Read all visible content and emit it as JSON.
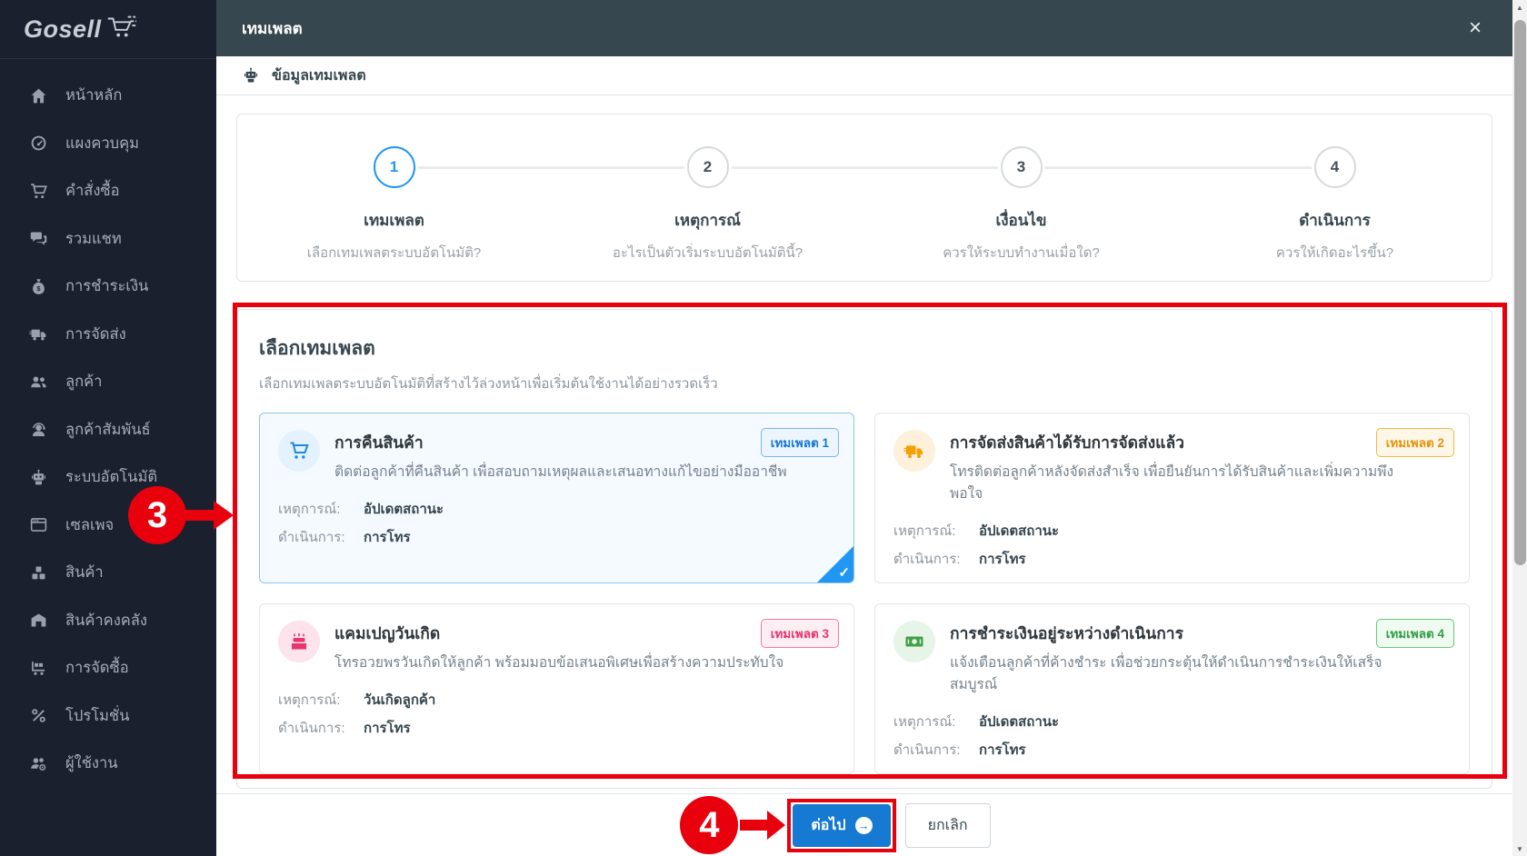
{
  "brand": {
    "name": "Gosell"
  },
  "sidebar": {
    "items": [
      {
        "label": "หน้าหลัก",
        "icon": "home-icon"
      },
      {
        "label": "แผงควบคุม",
        "icon": "dashboard-gauge-icon"
      },
      {
        "label": "คำสั่งซื้อ",
        "icon": "orders-cart-icon"
      },
      {
        "label": "รวมแชท",
        "icon": "chat-icon"
      },
      {
        "label": "การชำระเงิน",
        "icon": "payment-moneybag-icon"
      },
      {
        "label": "การจัดส่ง",
        "icon": "shipping-truck-icon"
      },
      {
        "label": "ลูกค้า",
        "icon": "customers-icon"
      },
      {
        "label": "ลูกค้าสัมพันธ์",
        "icon": "crm-agent-icon"
      },
      {
        "label": "ระบบอัตโนมัติ",
        "icon": "automation-robot-icon"
      },
      {
        "label": "เซลเพจ",
        "icon": "salepage-window-icon"
      },
      {
        "label": "สินค้า",
        "icon": "products-boxes-icon"
      },
      {
        "label": "สินค้าคงคลัง",
        "icon": "inventory-warehouse-icon"
      },
      {
        "label": "การจัดซื้อ",
        "icon": "purchasing-cart-icon"
      },
      {
        "label": "โปรโมชั่น",
        "icon": "promotion-percent-icon"
      },
      {
        "label": "ผู้ใช้งาน",
        "icon": "users-gear-icon"
      }
    ]
  },
  "modal": {
    "title": "เทมเพลต",
    "subheader": "ข้อมูลเทมเพลต",
    "steps": [
      {
        "number": "1",
        "label": "เทมเพลต",
        "description": "เลือกเทมเพลตระบบอัตโนมัติ?",
        "active": true
      },
      {
        "number": "2",
        "label": "เหตุการณ์",
        "description": "อะไรเป็นตัวเริ่มระบบอัตโนมัตินี้?",
        "active": false
      },
      {
        "number": "3",
        "label": "เงื่อนไข",
        "description": "ควรให้ระบบทำงานเมื่อใด?",
        "active": false
      },
      {
        "number": "4",
        "label": "ดำเนินการ",
        "description": "ควรให้เกิดอะไรขึ้น?",
        "active": false
      }
    ],
    "section": {
      "title": "เลือกเทมเพลต",
      "subtitle": "เลือกเทมเพลตระบบอัตโนมัติที่สร้างไว้ล่วงหน้าเพื่อเริ่มต้นใช้งานได้อย่างรวดเร็ว",
      "event_label": "เหตุการณ์:",
      "action_label": "ดำเนินการ:",
      "templates": [
        {
          "title": "การคืนสินค้า",
          "badge": "เทมเพลต 1",
          "description": "ติดต่อลูกค้าที่คืนสินค้า เพื่อสอบถามเหตุผลและเสนอทางแก้ไขอย่างมืออาชีพ",
          "event": "อัปเดตสถานะ",
          "action": "การโทร",
          "selected": true,
          "accent": "#2196f3",
          "icon": "cart-icon"
        },
        {
          "title": "การจัดส่งสินค้าได้รับการจัดส่งแล้ว",
          "badge": "เทมเพลต 2",
          "description": "โทรติดต่อลูกค้าหลังจัดส่งสำเร็จ เพื่อยืนยันการได้รับสินค้าและเพิ่มความพึงพอใจ",
          "event": "อัปเดตสถานะ",
          "action": "การโทร",
          "selected": false,
          "accent": "#f59f00",
          "icon": "truck-icon"
        },
        {
          "title": "แคมเปญวันเกิด",
          "badge": "เทมเพลต 3",
          "description": "โทรอวยพรวันเกิดให้ลูกค้า พร้อมมอบข้อเสนอพิเศษเพื่อสร้างความประทับใจ",
          "event": "วันเกิดลูกค้า",
          "action": "การโทร",
          "selected": false,
          "accent": "#e8356d",
          "icon": "cake-icon"
        },
        {
          "title": "การชำระเงินอยู่ระหว่างดำเนินการ",
          "badge": "เทมเพลต 4",
          "description": "แจ้งเตือนลูกค้าที่ค้างชำระ เพื่อช่วยกระตุ้นให้ดำเนินการชำระเงินให้เสร็จสมบูรณ์",
          "event": "อัปเดตสถานะ",
          "action": "การโทร",
          "selected": false,
          "accent": "#2f9e44",
          "icon": "banknote-icon"
        }
      ]
    },
    "footer": {
      "next_label": "ต่อไป",
      "cancel_label": "ยกเลิก"
    }
  },
  "annotations": {
    "color": "#e8000d",
    "step_badge_3": "3",
    "step_badge_4": "4"
  },
  "icons": {
    "close": "×",
    "check": "✓",
    "next_arrow": "→",
    "scroll_up": "▲",
    "scroll_down": "▼"
  },
  "colors": {
    "primary_blue": "#1679d2",
    "step_active_blue": "#2196f3",
    "header_bar": "#37474f",
    "sidebar_bg": "#1a202e",
    "annotation_red": "#e8000d"
  }
}
